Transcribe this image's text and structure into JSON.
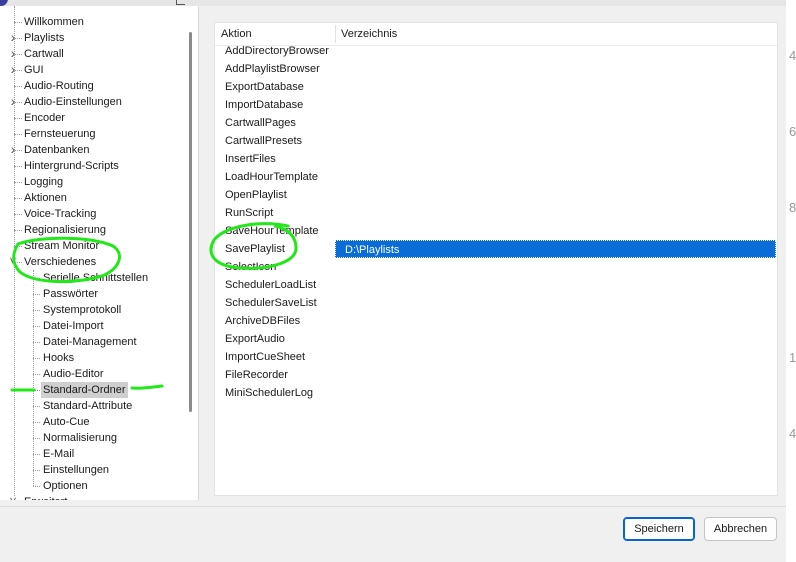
{
  "tree": {
    "items": [
      {
        "label": "Willkommen",
        "level": 0,
        "chevron": "none"
      },
      {
        "label": "Playlists",
        "level": 0,
        "chevron": "chevron-right-icon"
      },
      {
        "label": "Cartwall",
        "level": 0,
        "chevron": "chevron-right-icon"
      },
      {
        "label": "GUI",
        "level": 0,
        "chevron": "chevron-right-icon"
      },
      {
        "label": "Audio-Routing",
        "level": 0,
        "chevron": "none"
      },
      {
        "label": "Audio-Einstellungen",
        "level": 0,
        "chevron": "chevron-right-icon"
      },
      {
        "label": "Encoder",
        "level": 0,
        "chevron": "none"
      },
      {
        "label": "Fernsteuerung",
        "level": 0,
        "chevron": "none"
      },
      {
        "label": "Datenbanken",
        "level": 0,
        "chevron": "chevron-right-icon"
      },
      {
        "label": "Hintergrund-Scripts",
        "level": 0,
        "chevron": "none"
      },
      {
        "label": "Logging",
        "level": 0,
        "chevron": "none"
      },
      {
        "label": "Aktionen",
        "level": 0,
        "chevron": "none"
      },
      {
        "label": "Voice-Tracking",
        "level": 0,
        "chevron": "none"
      },
      {
        "label": "Regionalisierung",
        "level": 0,
        "chevron": "none"
      },
      {
        "label": "Stream Monitor",
        "level": 0,
        "chevron": "none"
      },
      {
        "label": "Verschiedenes",
        "level": 0,
        "chevron": "chevron-down-icon"
      },
      {
        "label": "Serielle Schnittstellen",
        "level": 1,
        "chevron": "none"
      },
      {
        "label": "Passwörter",
        "level": 1,
        "chevron": "none"
      },
      {
        "label": "Systemprotokoll",
        "level": 1,
        "chevron": "none"
      },
      {
        "label": "Datei-Import",
        "level": 1,
        "chevron": "none"
      },
      {
        "label": "Datei-Management",
        "level": 1,
        "chevron": "none"
      },
      {
        "label": "Hooks",
        "level": 1,
        "chevron": "none"
      },
      {
        "label": "Audio-Editor",
        "level": 1,
        "chevron": "none"
      },
      {
        "label": "Standard-Ordner",
        "level": 1,
        "chevron": "none",
        "selected": true
      },
      {
        "label": "Standard-Attribute",
        "level": 1,
        "chevron": "none"
      },
      {
        "label": "Auto-Cue",
        "level": 1,
        "chevron": "none"
      },
      {
        "label": "Normalisierung",
        "level": 1,
        "chevron": "none"
      },
      {
        "label": "E-Mail",
        "level": 1,
        "chevron": "none"
      },
      {
        "label": "Einstellungen",
        "level": 1,
        "chevron": "none"
      },
      {
        "label": "Optionen",
        "level": 1,
        "chevron": "none"
      },
      {
        "label": "Erweitert",
        "level": 0,
        "chevron": "chevron-down-icon"
      }
    ]
  },
  "list": {
    "columns": [
      "Aktion",
      "Verzeichnis"
    ],
    "rows": [
      {
        "action": "AddDirectoryBrowser",
        "dir": ""
      },
      {
        "action": "AddPlaylistBrowser",
        "dir": ""
      },
      {
        "action": "ExportDatabase",
        "dir": ""
      },
      {
        "action": "ImportDatabase",
        "dir": ""
      },
      {
        "action": "CartwallPages",
        "dir": ""
      },
      {
        "action": "CartwallPresets",
        "dir": ""
      },
      {
        "action": "InsertFiles",
        "dir": ""
      },
      {
        "action": "LoadHourTemplate",
        "dir": ""
      },
      {
        "action": "OpenPlaylist",
        "dir": ""
      },
      {
        "action": "RunScript",
        "dir": ""
      },
      {
        "action": "SaveHourTemplate",
        "dir": ""
      },
      {
        "action": "SavePlaylist",
        "dir": "D:\\Playlists",
        "selected": true
      },
      {
        "action": "SelectIcon",
        "dir": ""
      },
      {
        "action": "SchedulerLoadList",
        "dir": ""
      },
      {
        "action": "SchedulerSaveList",
        "dir": ""
      },
      {
        "action": "ArchiveDBFiles",
        "dir": ""
      },
      {
        "action": "ExportAudio",
        "dir": ""
      },
      {
        "action": "ImportCueSheet",
        "dir": ""
      },
      {
        "action": "FileRecorder",
        "dir": ""
      },
      {
        "action": "MiniSchedulerLog",
        "dir": ""
      }
    ]
  },
  "buttons": {
    "save": "Speichern",
    "cancel": "Abbrechen"
  },
  "right_edge_glyphs": [
    "4",
    "6",
    "8",
    "1",
    "4"
  ],
  "colors": {
    "selection": "#0a6cd6",
    "annotation": "#22e81a",
    "tree_selected": "#cfcfcf"
  }
}
